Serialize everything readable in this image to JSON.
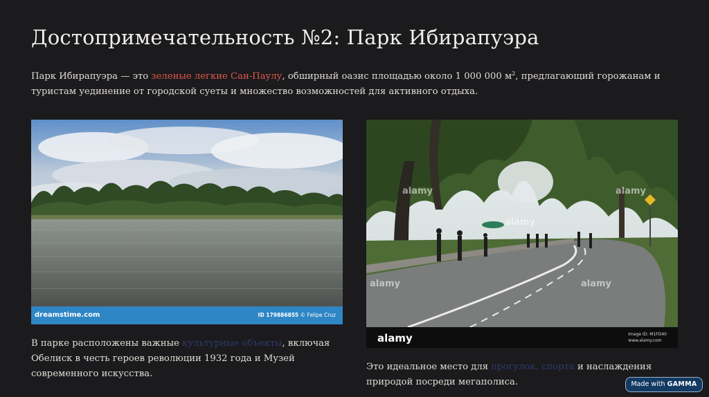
{
  "slide": {
    "title": "Достопримечательность №2: Парк Ибирапуэра",
    "intro": {
      "part1": "Парк Ибирапуэра — это ",
      "highlight": "зеленые легкие Сан-Паулу",
      "part2": ", обширный оазис площадью около 1 000 000 м",
      "sup": "2",
      "part3": ", предлагающий горожанам и туристам уединение от городской суеты и множество возможностей для активного отдыха."
    },
    "caption_left": {
      "part1": "В парке расположены важные ",
      "highlight": "культурные объекты",
      "part2": ", включая Обелиск в честь героев революции 1932 года и Музей современного искусства."
    },
    "caption_right": {
      "part1": "Это идеальное место для ",
      "highlight": "прогулок, спорта",
      "part2": " и наслаждения природой посреди мегаполиса."
    }
  },
  "photo_left": {
    "watermark_logo": "dreamstime.com",
    "id_text": "ID 179886855",
    "credit": "© Felipe Cruz",
    "bar_color": "#2e86c4"
  },
  "photo_right": {
    "watermark": "alamy",
    "logo": "alamy",
    "image_id": "Image ID: M1FD40",
    "site": "www.alamy.com"
  },
  "badge": {
    "prefix": "Made with",
    "brand": "GAMMA"
  },
  "colors": {
    "background": "#1b1a1c",
    "highlight_red": "#e1584f",
    "highlight_dark": "#2f3a6e",
    "badge_bg": "#123a63"
  }
}
